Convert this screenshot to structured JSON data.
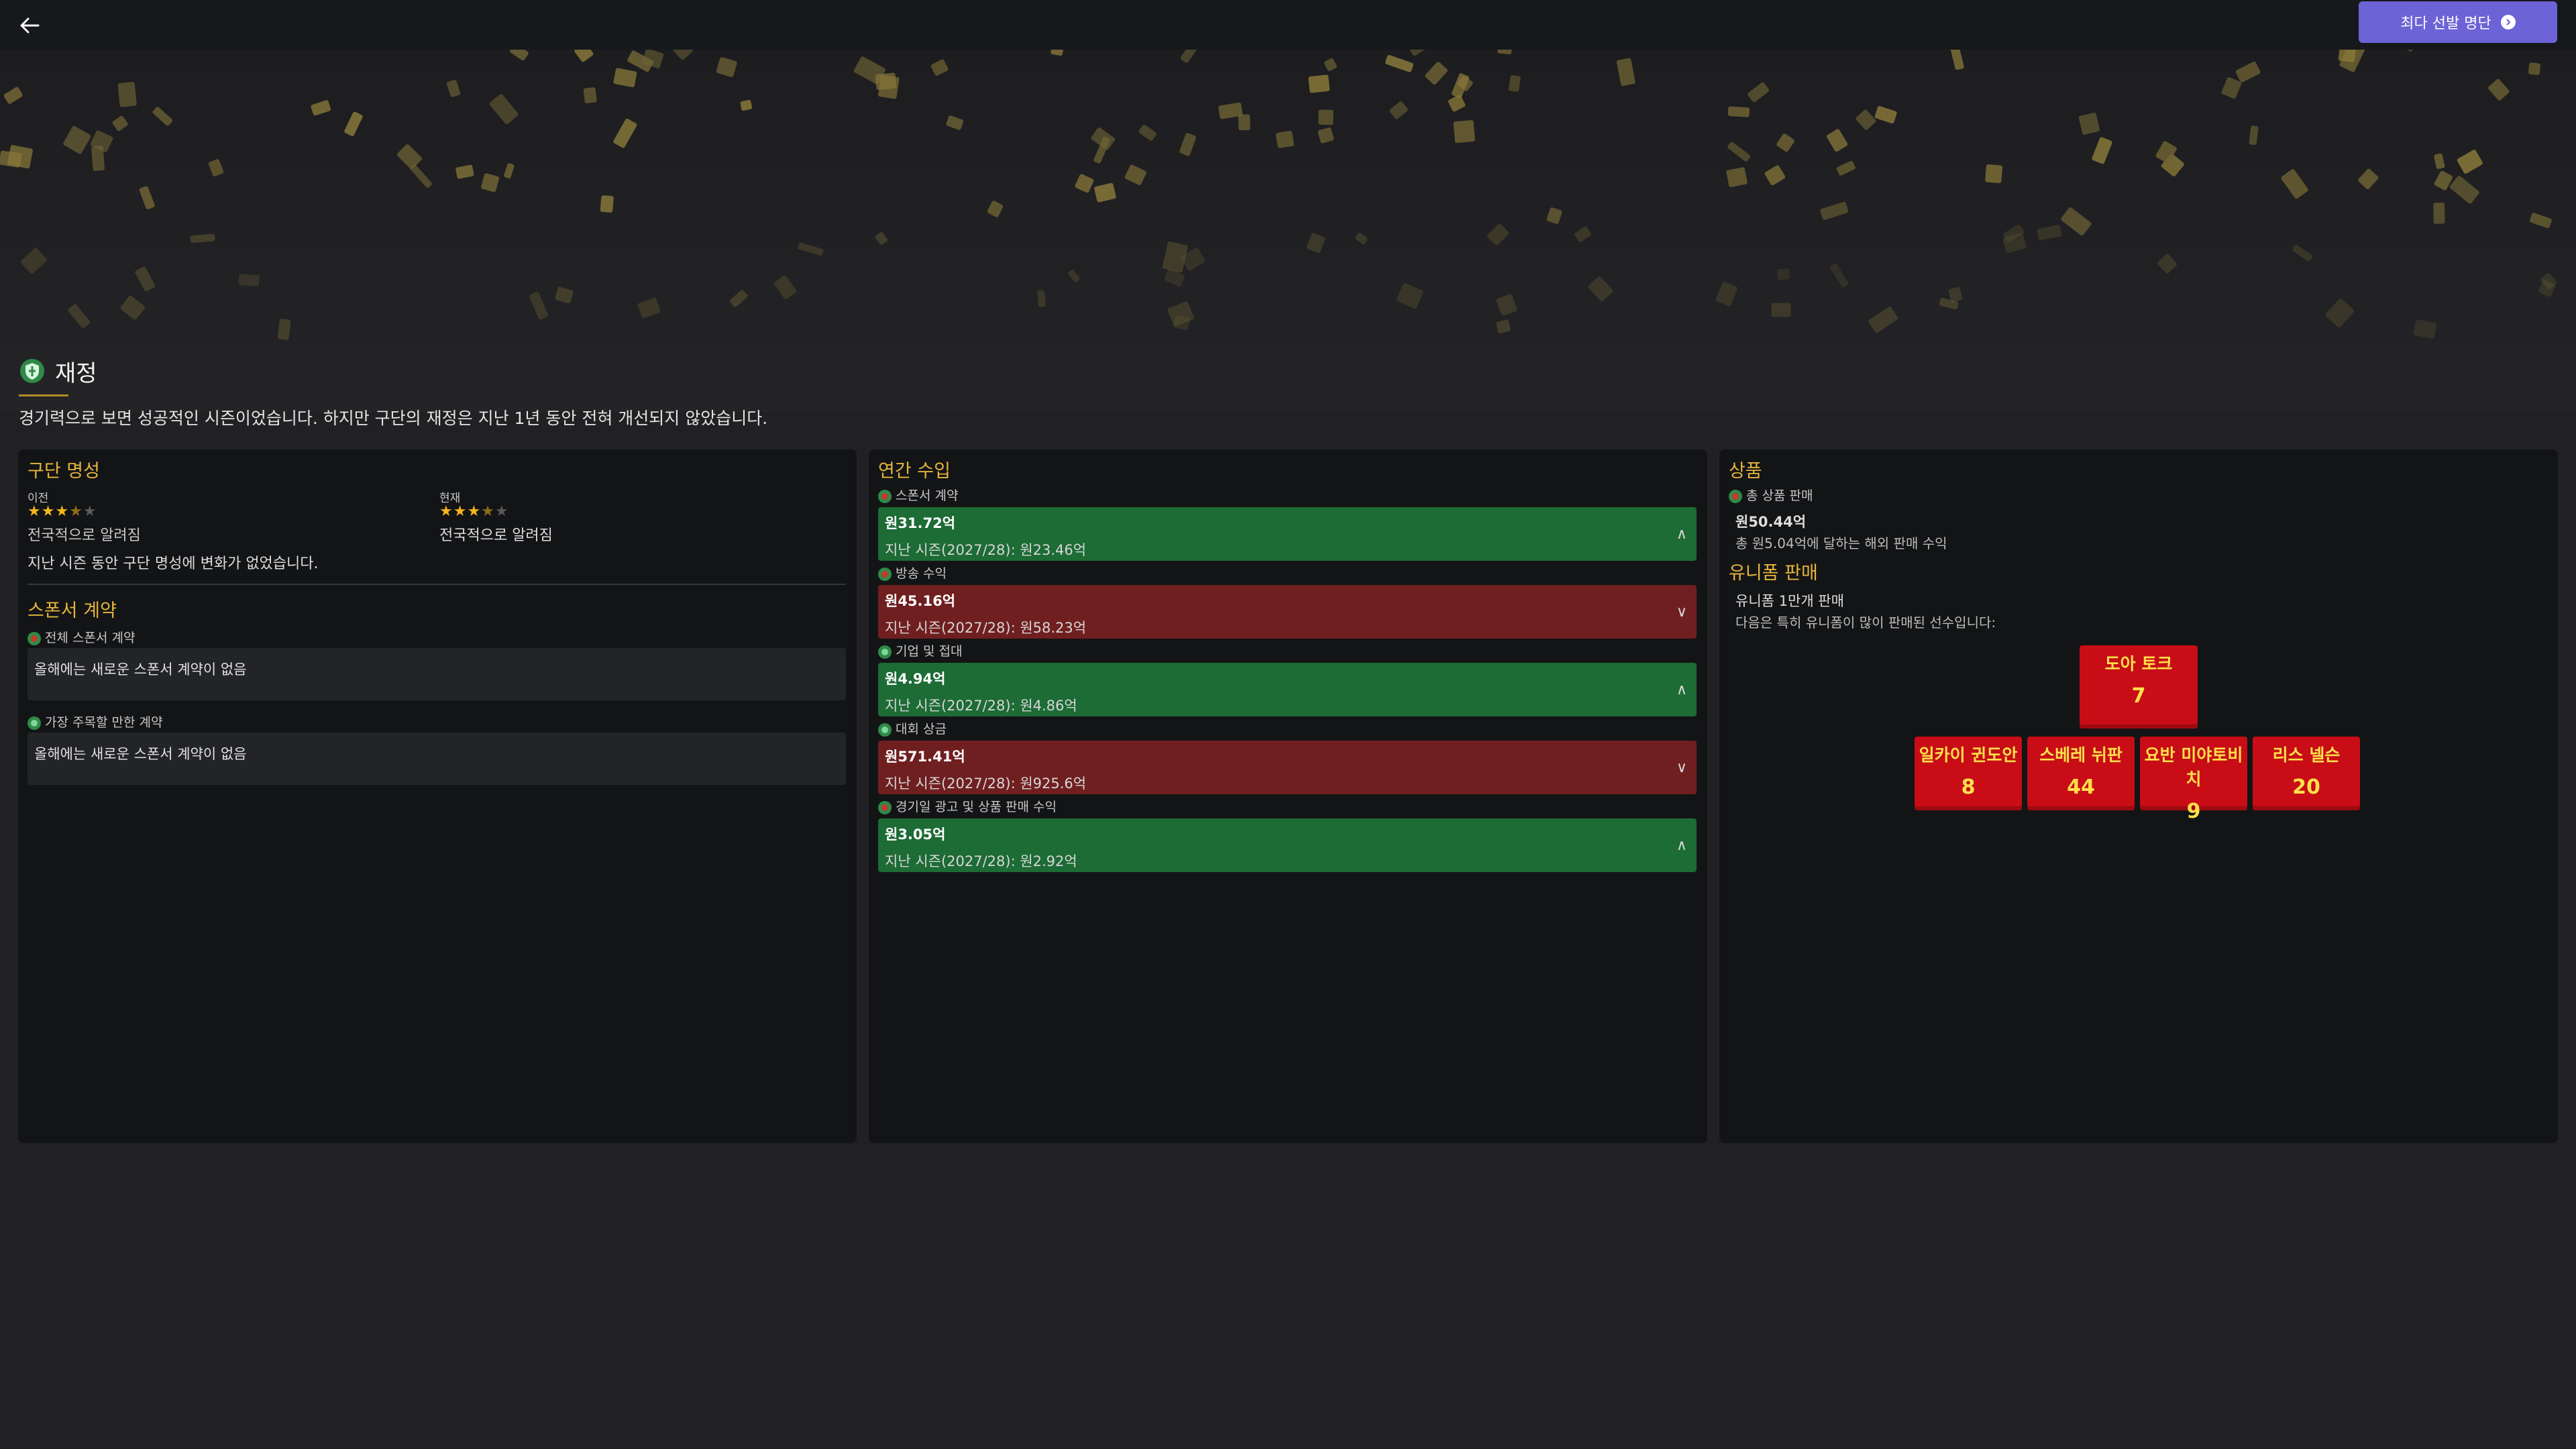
{
  "nav": {
    "next_label": "최다 선발 명단"
  },
  "section": {
    "title": "재정",
    "intro": "경기력으로 보면 성공적인 시즌이었습니다. 하지만 구단의 재정은 지난 1년 동안 전혀 개선되지 않았습니다."
  },
  "reputation": {
    "title": "구단 명성",
    "prev_label": "이전",
    "prev_stars": 3.5,
    "prev_text": "전국적으로 알려짐",
    "curr_label": "현재",
    "curr_stars": 3.5,
    "curr_text": "전국적으로 알려짐",
    "note": "지난 시즌 동안 구단 명성에 변화가 없었습니다."
  },
  "sponsors": {
    "title": "스폰서 계약",
    "total_label": "전체 스폰서 계약",
    "total_text": "올해에는 새로운 스폰서 계약이 없음",
    "notable_label": "가장 주목할 만한 계약",
    "notable_text": "올해에는 새로운 스폰서 계약이 없음"
  },
  "revenue": {
    "title": "연간 수입",
    "items": [
      {
        "label": "스폰서 계약",
        "value": "원31.72억",
        "prev": "지난 시즌(2027/28): 원23.46억",
        "trend": "up"
      },
      {
        "label": "방송 수익",
        "value": "원45.16억",
        "prev": "지난 시즌(2027/28): 원58.23억",
        "trend": "down"
      },
      {
        "label": "기업 및 접대",
        "value": "원4.94억",
        "prev": "지난 시즌(2027/28): 원4.86억",
        "trend": "up"
      },
      {
        "label": "대회 상금",
        "value": "원571.41억",
        "prev": "지난 시즌(2027/28): 원925.6억",
        "trend": "down"
      },
      {
        "label": "경기일 광고 및 상품 판매 수익",
        "value": "원3.05억",
        "prev": "지난 시즌(2027/28): 원2.92억",
        "trend": "up"
      }
    ]
  },
  "merch": {
    "title": "상품",
    "total_label": "총 상품 판매",
    "total_value": "원50.44억",
    "overseas": "총 원5.04억에 달하는 해외 판매 수익",
    "uniform_title": "유니폼 판매",
    "uniform_count": "유니폼 1만개 판매",
    "uniform_sub": "다음은 특히 유니폼이 많이 판매된 선수입니다:",
    "players": [
      {
        "name": "도아 토크",
        "number": "7"
      },
      {
        "name": "일카이 귄도안",
        "number": "8"
      },
      {
        "name": "스베레 뉘판",
        "number": "44"
      },
      {
        "name": "요반 미야토비치",
        "number": "9"
      },
      {
        "name": "리스 넬슨",
        "number": "20"
      }
    ]
  },
  "colors": {
    "accent": "#e4b53c",
    "up": "#1d6b35",
    "down": "#701f20",
    "button": "#6b63d6",
    "jersey": "#c80d16"
  }
}
